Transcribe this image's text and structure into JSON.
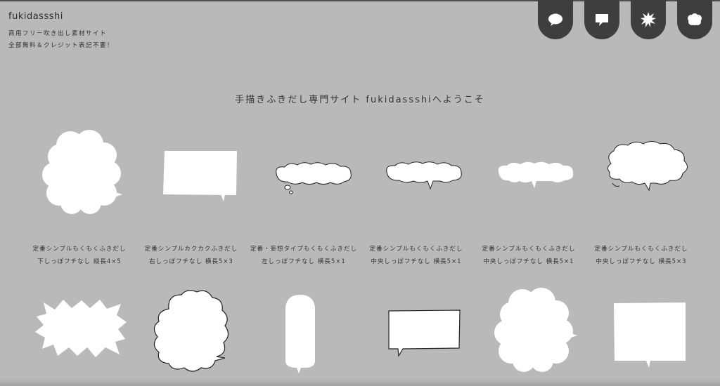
{
  "site": {
    "name": "fukidassshi",
    "tagline1": "商用フリー吹き出し素材サイト",
    "tagline2": "全部無料＆クレジット表記不要！"
  },
  "nav_tabs": [
    {
      "icon": "round-speech-bubble-icon"
    },
    {
      "icon": "square-speech-bubble-icon"
    },
    {
      "icon": "spiky-burst-icon"
    },
    {
      "icon": "cloud-bubble-icon"
    }
  ],
  "welcome": "手描きふきだし専門サイト fukidassshiへようこそ",
  "items_row1": [
    {
      "line1": "定番シンプルもくもくふきだし",
      "line2": "下しっぽフチなし 縦長4×5"
    },
    {
      "line1": "定番シンプルカクカクふきだし",
      "line2": "右しっぽフチなし 横長5×3"
    },
    {
      "line1": "定番・妄想タイプもくもくふきだし",
      "line2": "左しっぽフチなし 横長5×1"
    },
    {
      "line1": "定番シンプルもくもくふきだし",
      "line2": "中央しっぽフチなし 横長5×1"
    },
    {
      "line1": "定番シンプルもくもくふきだし",
      "line2": "中央しっぽフチなし 横長5×1"
    },
    {
      "line1": "定番シンプルもくもくふきだし",
      "line2": "中央しっぽフチなし 横長5×3"
    }
  ],
  "colors": {
    "background": "#b9b9b9",
    "tab": "#3e3e3e",
    "bubble": "#ffffff"
  }
}
